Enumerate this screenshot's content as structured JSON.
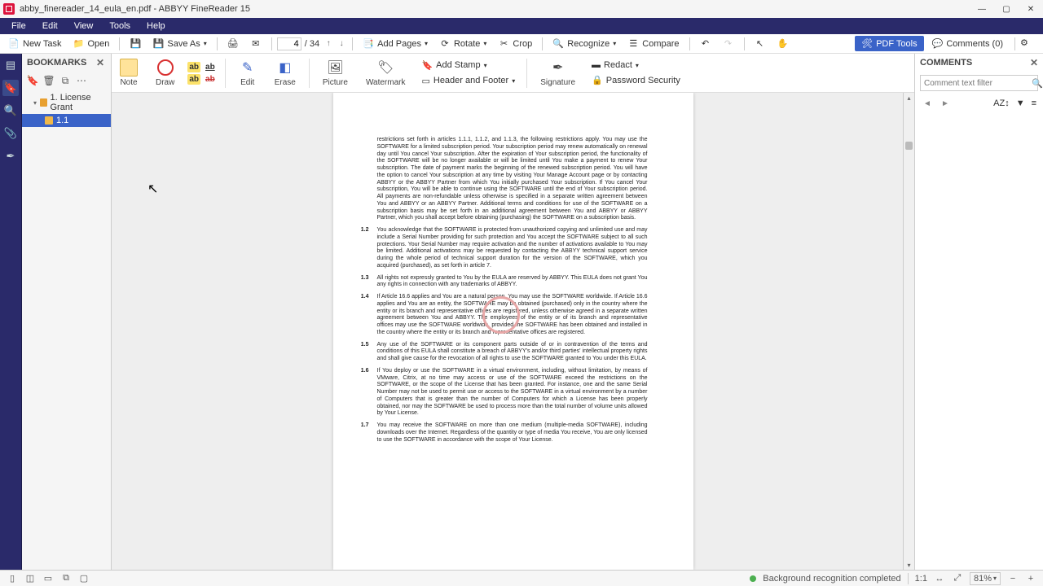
{
  "title_bar": {
    "text": "abby_finereader_14_eula_en.pdf - ABBYY FineReader 15"
  },
  "menu": {
    "file": "File",
    "edit": "Edit",
    "view": "View",
    "tools": "Tools",
    "help": "Help"
  },
  "toolbar": {
    "new_task": "New Task",
    "open": "Open",
    "save_as": "Save As",
    "page_current": "4",
    "page_total": "/ 34",
    "add_pages": "Add Pages",
    "rotate": "Rotate",
    "crop": "Crop",
    "recognize": "Recognize",
    "compare": "Compare",
    "pdf_tools": "PDF Tools",
    "comments": "Comments (0)"
  },
  "ribbon": {
    "note": "Note",
    "draw": "Draw",
    "edit": "Edit",
    "erase": "Erase",
    "picture": "Picture",
    "watermark": "Watermark",
    "signature": "Signature",
    "add_stamp": "Add Stamp",
    "header_footer": "Header and Footer",
    "redact": "Redact",
    "password": "Password Security",
    "ab": "ab"
  },
  "bookmarks": {
    "title": "BOOKMARKS",
    "items": [
      {
        "label": "1. License Grant"
      },
      {
        "label": "1.1"
      }
    ]
  },
  "comments_panel": {
    "title": "COMMENTS",
    "filter_placeholder": "Comment text filter",
    "sort": "AZ"
  },
  "status": {
    "recognition": "Background recognition completed",
    "ratio": "1:1",
    "zoom": "81%"
  },
  "document": {
    "p_intro": "restrictions set forth in articles 1.1.1, 1.1.2, and 1.1.3, the following restrictions apply. You may use the SOFTWARE for a limited subscription period. Your subscription period may renew automatically on renewal day until You cancel Your subscription. After the expiration of Your subscription period, the functionality of the SOFTWARE will be no longer available or will be limited until You make a payment to renew Your subscription. The date of payment marks the beginning of the renewed subscription period. You will have the option to cancel Your subscription at any time by visiting Your Manage Account page or by contacting ABBYY or the ABBYY Partner from which You initially purchased Your subscription. If You cancel Your subscription, You will be able to continue using the SOFTWARE until the end of Your subscription period. All payments are non-refundable unless otherwise is specified in a separate written agreement between You and ABBYY or an ABBYY Partner. Additional terms and conditions for use of the SOFTWARE on a subscription basis may be set forth in an additional agreement between You and ABBYY or ABBYY Partner, which you shall accept before obtaining (purchasing) the SOFTWARE on a subscription basis.",
    "p12_num": "1.2",
    "p12": "You acknowledge that the SOFTWARE is protected from unauthorized copying and unlimited use and may include a Serial Number providing for such protection and You accept the SOFTWARE subject to all such protections. Your Serial Number may require activation and the number of activations available to You may be limited. Additional activations may be requested by contacting the ABBYY technical support service during the whole period of technical support duration for the version of the SOFTWARE, which you acquired (purchased), as set forth in article 7.",
    "p13_num": "1.3",
    "p13": "All rights not expressly granted to You by the EULA are reserved by ABBYY. This EULA does not grant You any rights in connection with any trademarks of ABBYY.",
    "p14_num": "1.4",
    "p14": "If Article 16.6 applies and You are a natural person, You may use the SOFTWARE worldwide. If Article 16.6 applies and You are an entity, the SOFTWARE may be obtained (purchased) only in the country where the entity or its branch and representative offices are registered, unless otherwise agreed in a separate written agreement between You and ABBYY. The employees of the entity or of its branch and representative offices may use the SOFTWARE worldwide, provided the SOFTWARE has been obtained and installed in the country where the entity or its branch and representative offices are registered.",
    "p15_num": "1.5",
    "p15": "Any use of the SOFTWARE or its component parts outside of or in contravention of the terms and conditions of this EULA shall constitute a breach of ABBYY's and/or third parties' intellectual property rights and shall give cause for the revocation of all rights to use the SOFTWARE granted to You under this EULA.",
    "p16_num": "1.6",
    "p16": "If You deploy or use the SOFTWARE in a virtual environment, including, without limitation, by means of VMware, Citrix, at no time may access or use of the SOFTWARE exceed the restrictions on the SOFTWARE, or the scope of the License that has been granted. For instance, one and the same Serial Number may not be used to permit use or access to the SOFTWARE in a virtual environment by a number of Computers that is greater than the number of Computers for which a License has been properly obtained, nor may the SOFTWARE be used to process more than the total number of volume units allowed by Your License.",
    "p17_num": "1.7",
    "p17": "You may receive the SOFTWARE on more than one medium (multiple-media SOFTWARE), including downloads over the Internet. Regardless of the quantity or type of media You receive, You are only licensed to use the SOFTWARE in accordance with the scope of Your License."
  }
}
